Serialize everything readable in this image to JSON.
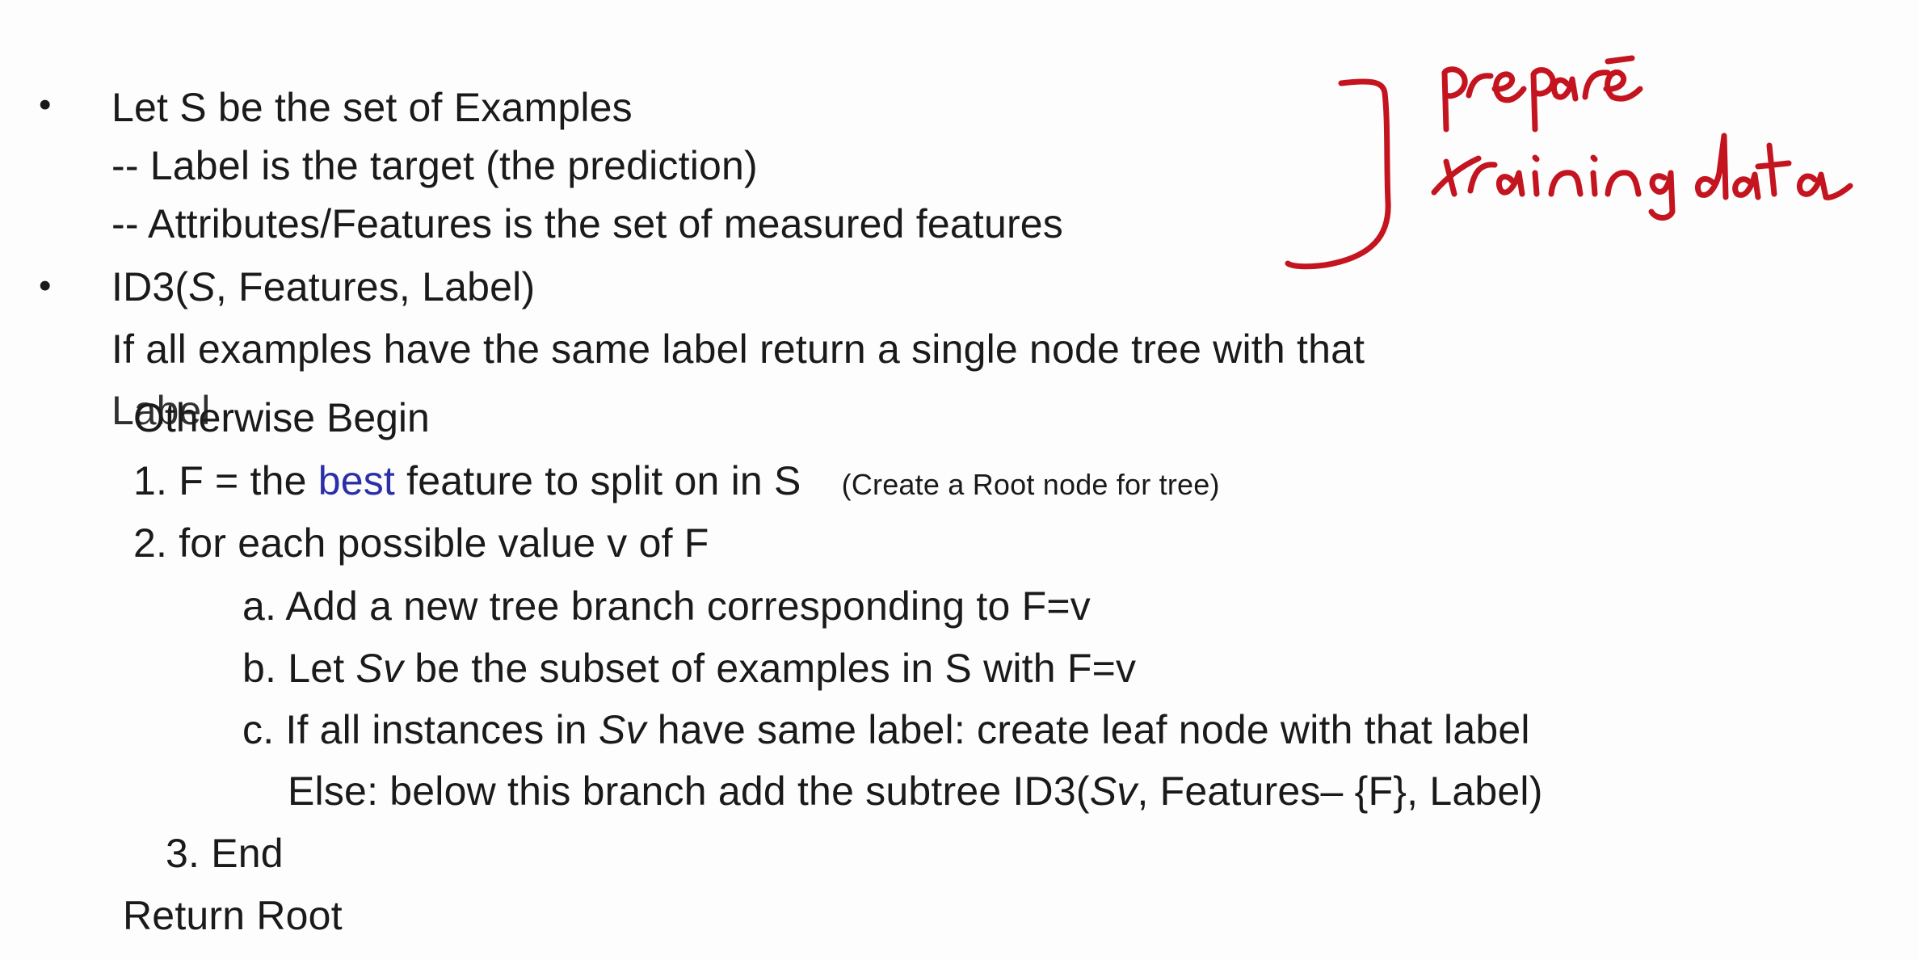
{
  "bullets": [
    {
      "head": "Let  S be the set of Examples",
      "subs": [
        "-- Label  is the target (the prediction)",
        "-- Attributes/Features is the set of measured features"
      ]
    },
    {
      "head_prefix": "ID3(",
      "head_italic": "S",
      "head_suffix": ", Features, Label)"
    }
  ],
  "algorithm": {
    "if_line": "If all examples have the same label return a single node tree with that",
    "if_line_wrap": "Label",
    "otherwise": "Otherwise Begin",
    "step1": {
      "prefix": "1. F =  the ",
      "highlight": "best",
      "suffix": " feature to split on in S",
      "note": "(Create a Root node for tree)"
    },
    "step2": "2. for each possible value v of F",
    "step2a": "a. Add a new tree branch corresponding to F=v",
    "step2b": {
      "prefix": "b. Let ",
      "italic": "Sv",
      "suffix": "  be the subset of examples in S with F=v"
    },
    "step2c": {
      "prefix": "c. If all instances in ",
      "italic": "Sv",
      "suffix": " have same label: create leaf node with that label"
    },
    "step2c_else": {
      "prefix": "Else:  below this branch add the subtree ID3(",
      "italic": "Sv",
      "suffix": ", Features– {F}, Label)"
    },
    "step3": "3. End",
    "return": "Return Root"
  },
  "annotation": {
    "text_line1": "prepare",
    "text_line2": "training data",
    "ink_color": "#c4141f"
  },
  "colors": {
    "text": "#1a1a1a",
    "highlight": "#2b2fa8"
  }
}
